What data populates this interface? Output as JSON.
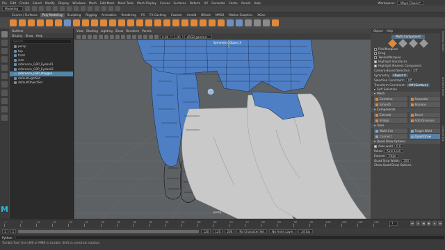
{
  "menubar": {
    "items": [
      "File",
      "Edit",
      "Create",
      "Select",
      "Modify",
      "Display",
      "Windows",
      "Mesh",
      "Edit Mesh",
      "Mesh Tools",
      "Mesh Display",
      "Curves",
      "Surfaces",
      "Deform",
      "UV",
      "Generate",
      "Cache",
      "Arnold",
      "Help"
    ],
    "workspace_label": "Workspace:",
    "workspace_value": "Maya Classic*"
  },
  "statusline": {
    "mode": "Modeling"
  },
  "shelf": {
    "tabs": [
      "Curves / Surfaces",
      "Poly Modeling",
      "Sculpting",
      "Rigging",
      "Animation",
      "Rendering",
      "FX",
      "FX Caching",
      "Custom",
      "Arnold",
      "Bifrost",
      "MASH",
      "Motion Graphics",
      "XGen"
    ],
    "active_tab": "Poly Modeling"
  },
  "outliner": {
    "title": "Outliner",
    "menu": [
      "Display",
      "Show",
      "Help"
    ],
    "search_placeholder": "Search...",
    "items": [
      "persp",
      "top",
      "front",
      "side",
      "reference_GRP_Eyeball1",
      "reference_GRP_Eyeball2",
      "reference_GRP_Polygon",
      "defaultLightSet",
      "defaultObjectSet"
    ],
    "selected_index": 6
  },
  "viewport": {
    "menu": [
      "View",
      "Shading",
      "Lighting",
      "Show",
      "Renderer",
      "Panels"
    ],
    "field_a": "0.00",
    "field_b": "1.00",
    "colorspace": "sRGB gamma",
    "symmetry_label": "Symmetry: Object X",
    "camera_label": "persp"
  },
  "attribute_panel": {
    "tabs": [
      "Object",
      "Help"
    ],
    "tool_title": "Multi-Component",
    "options": [
      {
        "label": "Pick/Marquee",
        "checked": false
      },
      {
        "label": "Drag",
        "checked": false
      },
      {
        "label": "Tweak/Marquee",
        "checked": false
      },
      {
        "label": "Highlight Backfaces",
        "checked": true
      },
      {
        "label": "Highlight Nearest Component",
        "checked": true
      }
    ],
    "camera_based_label": "Camera-Based Selection",
    "camera_based_value": "Off",
    "symmetry_label": "Symmetry:",
    "symmetry_value": "Object X",
    "selection_constraint_label": "Selection Constraint:",
    "selection_constraint_value": "Off",
    "transform_constraint_label": "Transform Constraint:",
    "transform_constraint_value": "Off (Surface)",
    "soft_selection": "Soft Selection",
    "mesh_header": "Mesh",
    "mesh_buttons": [
      "Combine",
      "Separate",
      "Smooth",
      "Boolean"
    ],
    "components_header": "Components",
    "components_buttons": [
      "Extrude",
      "Bevel",
      "Bridge",
      "Add Divisions"
    ],
    "tools_header": "Tools",
    "tools_buttons": [
      "Multi-Cut",
      "Target Weld",
      "Connect",
      "Quad Draw"
    ],
    "quad_draw_header": "Quad Draw Options",
    "auto_weld_label": "Auto weld",
    "auto_weld_value": "0.0",
    "relax_label": "Relax:",
    "relax_value": "Auto Lock",
    "extend_label": "Extend:",
    "extend_value": "Edge",
    "strip_width_label": "Quad Strip Width:",
    "strip_width_value": "200",
    "footer": "Show Quad Draw Options"
  },
  "sidestrip": {
    "labels": [
      "Modeling Toolkit",
      "Attribute Editor",
      "Channel Box"
    ]
  },
  "timeslider": {
    "ticks": [
      "1",
      "5",
      "10",
      "15",
      "20",
      "25",
      "30",
      "35",
      "40",
      "45",
      "50",
      "55",
      "60",
      "65",
      "70",
      "75",
      "80",
      "85",
      "90",
      "95",
      "100",
      "105",
      "110",
      "115",
      "120"
    ],
    "current_frame": "1"
  },
  "rangeslider": {
    "start": "1",
    "inner_start": "1",
    "inner_end": "120",
    "end": "120",
    "end2": "200",
    "character_set": "No Character Set",
    "anim_layer": "No Anim Layer",
    "fps": "24 fps"
  },
  "cmdline": {
    "label": "Python"
  },
  "helpline": {
    "text": "Tumble Tool: Use LMB or MMB to tumble. Shift to constrain rotation."
  },
  "colors": {
    "mesh_blue": "#4e7fc4",
    "accent_orange": "#e0893a",
    "selection_blue": "#5285a6",
    "maya_cyan": "#2fb5d8"
  }
}
